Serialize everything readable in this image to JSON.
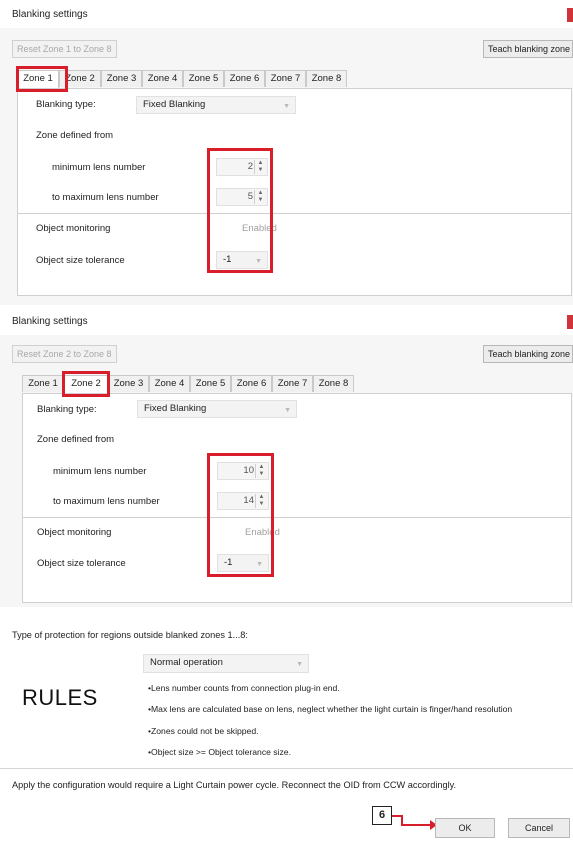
{
  "dialog1": {
    "title": "Blanking settings",
    "reset_button": "Reset Zone 1 to Zone 8",
    "teach_button": "Teach blanking zone",
    "tabs": [
      "Zone 1",
      "Zone 2",
      "Zone 3",
      "Zone 4",
      "Zone 5",
      "Zone 6",
      "Zone 7",
      "Zone 8"
    ],
    "active_tab": "Zone 1",
    "blanking_type_label": "Blanking type:",
    "blanking_type_value": "Fixed Blanking",
    "zone_defined_label": "Zone defined from",
    "min_lens_label": "minimum lens number",
    "min_lens_value": "2",
    "max_lens_label": "to maximum lens number",
    "max_lens_value": "5",
    "object_monitoring_label": "Object monitoring",
    "object_monitoring_value": "Enabled",
    "object_size_tolerance_label": "Object size tolerance",
    "object_size_tolerance_value": "-1"
  },
  "dialog2": {
    "title": "Blanking settings",
    "reset_button": "Reset Zone 2 to Zone 8",
    "teach_button": "Teach blanking zone",
    "tabs": [
      "Zone 1",
      "Zone 2",
      "Zone 3",
      "Zone 4",
      "Zone 5",
      "Zone 6",
      "Zone 7",
      "Zone 8"
    ],
    "active_tab": "Zone 2",
    "blanking_type_label": "Blanking type:",
    "blanking_type_value": "Fixed Blanking",
    "zone_defined_label": "Zone defined from",
    "min_lens_label": "minimum lens number",
    "min_lens_value": "10",
    "max_lens_label": "to maximum lens number",
    "max_lens_value": "14",
    "object_monitoring_label": "Object monitoring",
    "object_monitoring_value": "Enabled",
    "object_size_tolerance_label": "Object size tolerance",
    "object_size_tolerance_value": "-1"
  },
  "protection": {
    "label": "Type of protection for regions outside blanked zones 1...8:",
    "value": "Normal operation"
  },
  "rules": {
    "heading": "RULES",
    "items": [
      "•Lens number counts from connection plug-in end.",
      "•Max lens are calculated base on lens, neglect whether the light curtain is finger/hand resolution",
      "•Zones could not be skipped.",
      "•Object size >= Object tolerance size."
    ]
  },
  "footer": {
    "message": "Apply the configuration would require a Light Curtain power cycle.    Reconnect the OID from CCW accordingly.",
    "callout": "6",
    "ok_button": "OK",
    "cancel_button": "Cancel"
  },
  "colors": {
    "highlight": "#d81e2a",
    "close_button": "#d0333a"
  }
}
